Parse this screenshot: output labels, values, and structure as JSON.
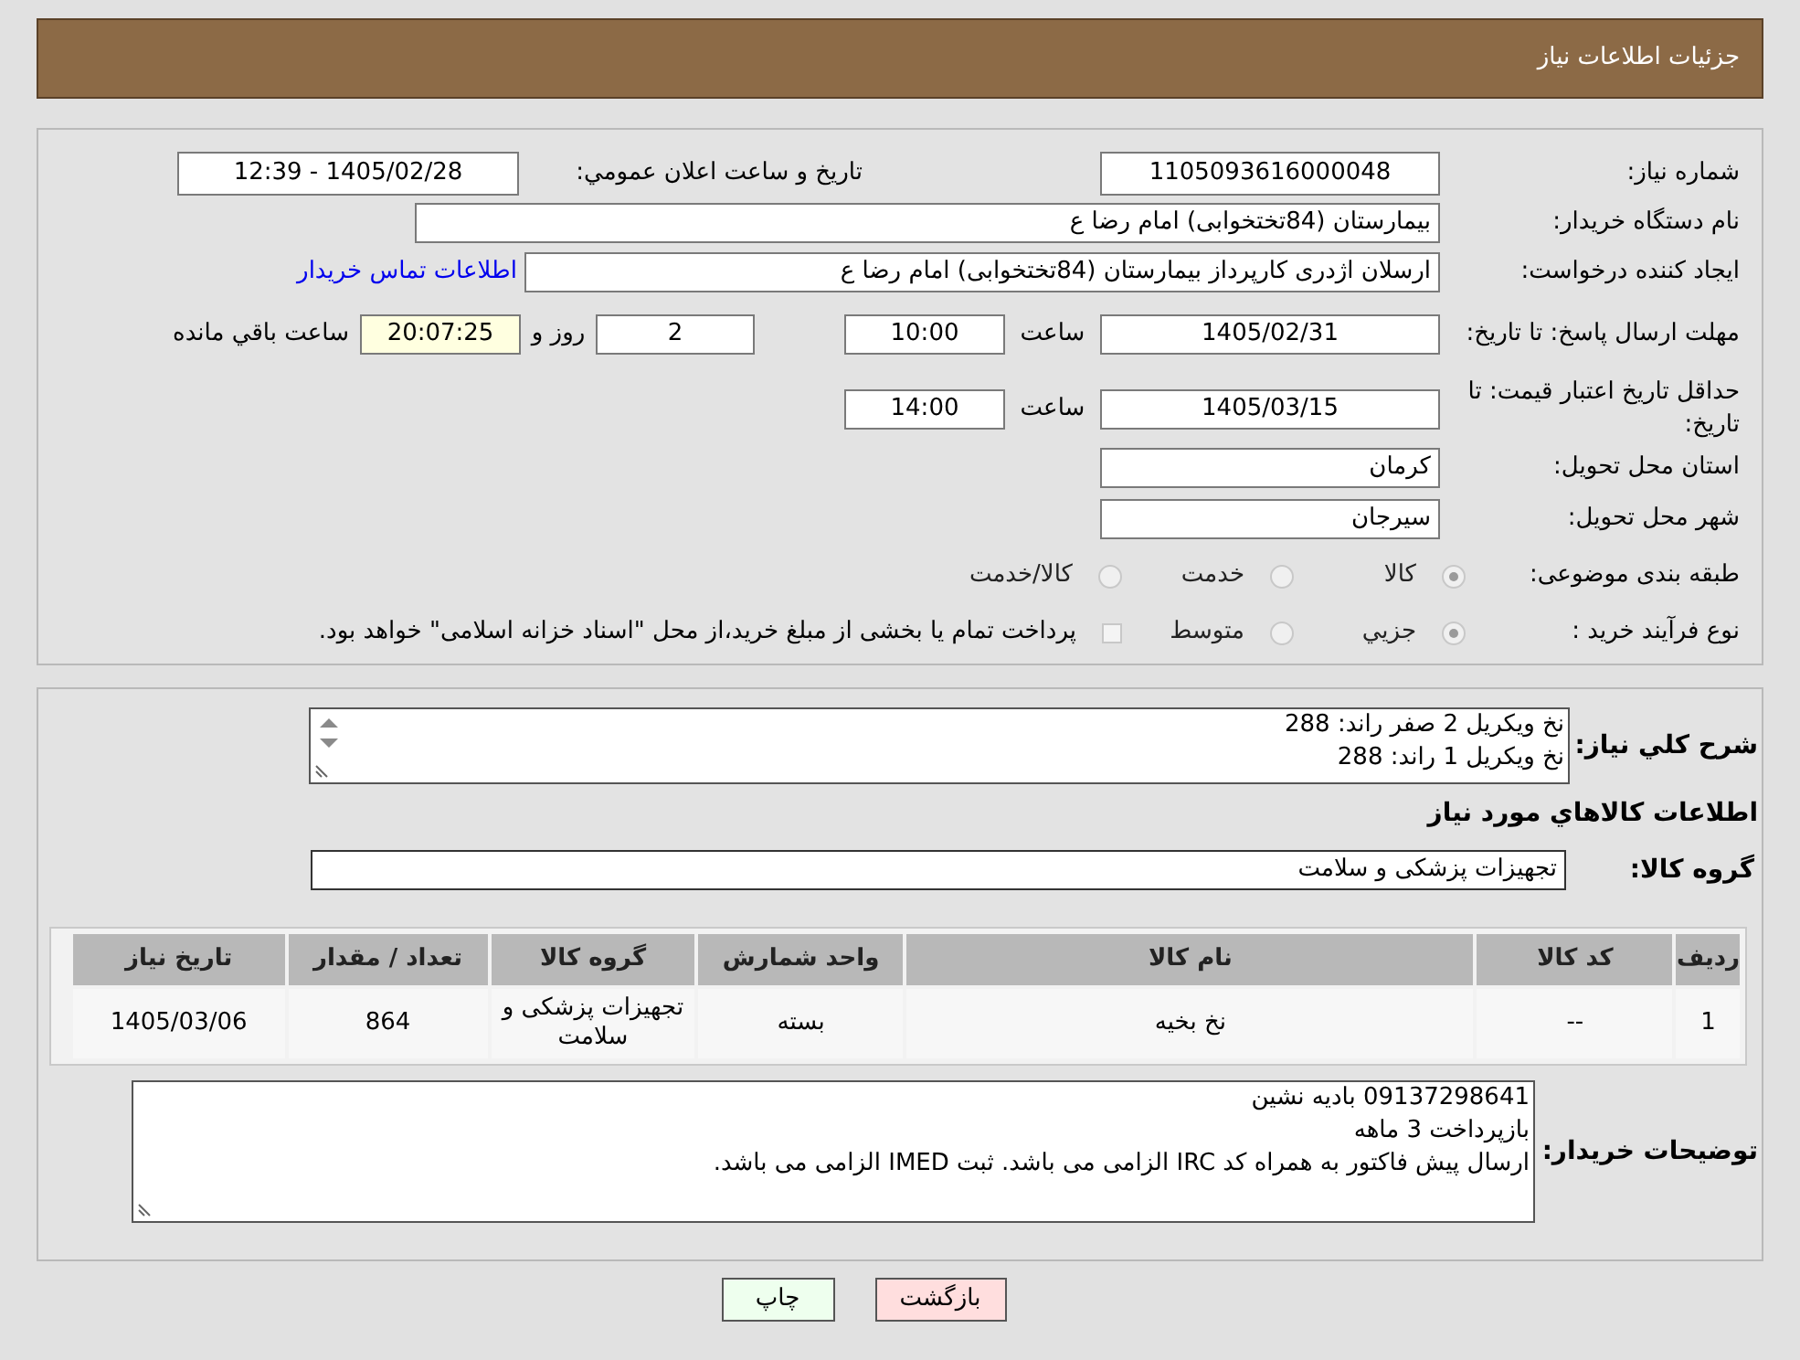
{
  "header": {
    "title": "جزئیات اطلاعات نیاز"
  },
  "need_number": {
    "label": "شماره نیاز:",
    "value": "1105093616000048"
  },
  "announce": {
    "label": "تاريخ و ساعت اعلان عمومي:",
    "value": "1405/02/28 - 12:39"
  },
  "buyer_org": {
    "label": "نام دستگاه خریدار:",
    "value": "بیمارستان (84تختخوابی) امام رضا  ع"
  },
  "requester": {
    "label": "ایجاد کننده درخواست:",
    "value": "ارسلان اژدری کارپرداز بیمارستان (84تختخوابی) امام رضا  ع",
    "link": "اطلاعات تماس خریدار"
  },
  "deadline": {
    "label": "مهلت ارسال پاسخ: تا تاریخ:",
    "date": "1405/02/31",
    "time_label": "ساعت",
    "time": "10:00",
    "days": "2",
    "days_label": "روز و",
    "remaining": "20:07:25",
    "remaining_label": "ساعت باقي مانده"
  },
  "validity": {
    "label": "حداقل تاریخ اعتبار قیمت: تا تاریخ:",
    "date": "1405/03/15",
    "time_label": "ساعت",
    "time": "14:00"
  },
  "province": {
    "label": "استان محل تحویل:",
    "value": "کرمان"
  },
  "city": {
    "label": "شهر محل تحویل:",
    "value": "سیرجان"
  },
  "category": {
    "label": "طبقه بندی موضوعی:",
    "options": [
      {
        "label": "کالا",
        "selected": true
      },
      {
        "label": "خدمت",
        "selected": false
      },
      {
        "label": "کالا/خدمت",
        "selected": false
      }
    ]
  },
  "purchase_type": {
    "label": "نوع فرآیند خرید :",
    "options": [
      {
        "label": "جزيي",
        "selected": true
      },
      {
        "label": "متوسط",
        "selected": false
      }
    ],
    "note": {
      "checked": false,
      "text": "پرداخت تمام یا بخشی از مبلغ خرید،از محل \"اسناد خزانه اسلامی\" خواهد بود."
    }
  },
  "description": {
    "label": "شرح كلي نياز:",
    "lines": [
      "نخ ویکریل 2 صفر راند: 288",
      "نخ ویکریل 1 راند: 288"
    ]
  },
  "goods_heading": "اطلاعات كالاهاي مورد نياز",
  "goods_group": {
    "label": "گروه کالا:",
    "value": "تجهیزات پزشکی و سلامت"
  },
  "table": {
    "columns": [
      "ردیف",
      "کد کالا",
      "نام کالا",
      "واحد شمارش",
      "گروه کالا",
      "تعداد / مقدار",
      "تاریخ نیاز"
    ],
    "rows": [
      [
        "1",
        "--",
        "نخ بخیه",
        "بسته",
        "تجهیزات پزشکی و سلامت",
        "864",
        "1405/03/06"
      ]
    ]
  },
  "buyer_notes": {
    "label": "توضیحات خریدار:",
    "lines": [
      "09137298641 بادیه نشین",
      "بازپرداخت 3 ماهه",
      "ارسال پیش فاکتور به همراه کد IRC الزامی می باشد. ثبت IMED الزامی می باشد."
    ]
  },
  "buttons": [
    {
      "kind": "back",
      "label": "بازگشت"
    },
    {
      "kind": "print",
      "label": "چاپ"
    }
  ]
}
